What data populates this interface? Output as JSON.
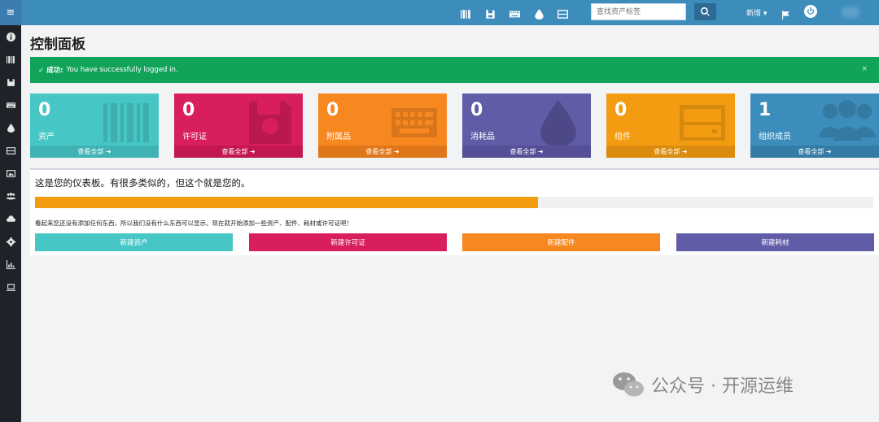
{
  "topbar": {
    "search_placeholder": "查找资产标签",
    "new_menu_label": "新增 ▾"
  },
  "page": {
    "title": "控制面板"
  },
  "alert": {
    "prefix": "✓ 成功:",
    "message": "You have successfully logged in.",
    "close": "×"
  },
  "tiles": [
    {
      "count": "0",
      "label": "资产",
      "link": "查看全部 ➜",
      "color": "#47c6c6",
      "foot_color": "#3fb3b3",
      "icon": "barcode-icon"
    },
    {
      "count": "0",
      "label": "许可证",
      "link": "查看全部 ➜",
      "color": "#d81e5b",
      "foot_color": "#c2184f",
      "icon": "floppy-disk-icon"
    },
    {
      "count": "0",
      "label": "附属品",
      "link": "查看全部 ➜",
      "color": "#f7871f",
      "foot_color": "#e0761a",
      "icon": "keyboard-icon"
    },
    {
      "count": "0",
      "label": "消耗品",
      "link": "查看全部 ➜",
      "color": "#605ca8",
      "foot_color": "#544f96",
      "icon": "droplet-icon"
    },
    {
      "count": "0",
      "label": "组件",
      "link": "查看全部 ➜",
      "color": "#f39c12",
      "foot_color": "#db8c0f",
      "icon": "hard-drive-icon"
    },
    {
      "count": "1",
      "label": "组织成员",
      "link": "查看全部 ➜",
      "color": "#3c8dbc",
      "foot_color": "#347ca6",
      "icon": "users-icon"
    }
  ],
  "dashboard": {
    "heading": "这是您的仪表板。有很多类似的，但这个就是您的。",
    "progress": 0.6,
    "message": "看起来您还没有添加任何东西，所以我们没有什么东西可以显示。现在就开始添加一些资产、配件、耗材或许可证吧！",
    "buttons": [
      {
        "label": "新建资产",
        "color": "#47c6c6"
      },
      {
        "label": "新建许可证",
        "color": "#d81e5b"
      },
      {
        "label": "新建配件",
        "color": "#f7871f"
      },
      {
        "label": "新建耗材",
        "color": "#605ca8"
      }
    ]
  },
  "watermark": {
    "text": "公众号 · 开源运维"
  }
}
